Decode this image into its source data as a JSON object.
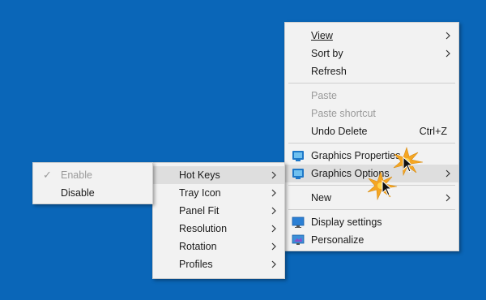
{
  "desktop_menu": {
    "view": "View",
    "sort_by": "Sort by",
    "refresh": "Refresh",
    "paste": "Paste",
    "paste_shortcut": "Paste shortcut",
    "undo_delete": "Undo Delete",
    "undo_shortcut": "Ctrl+Z",
    "graphics_properties": "Graphics Properties...",
    "graphics_options": "Graphics Options",
    "new": "New",
    "display_settings": "Display settings",
    "personalize": "Personalize"
  },
  "graphics_submenu": {
    "items": [
      "Hot Keys",
      "Tray Icon",
      "Panel Fit",
      "Resolution",
      "Rotation",
      "Profiles"
    ]
  },
  "hotkeys_submenu": {
    "enable": "Enable",
    "disable": "Disable"
  },
  "colors": {
    "desktop": "#0a66b8",
    "menu_bg": "#f2f2f2",
    "highlight": "#dedede",
    "disabled_text": "#9a9a9a"
  }
}
